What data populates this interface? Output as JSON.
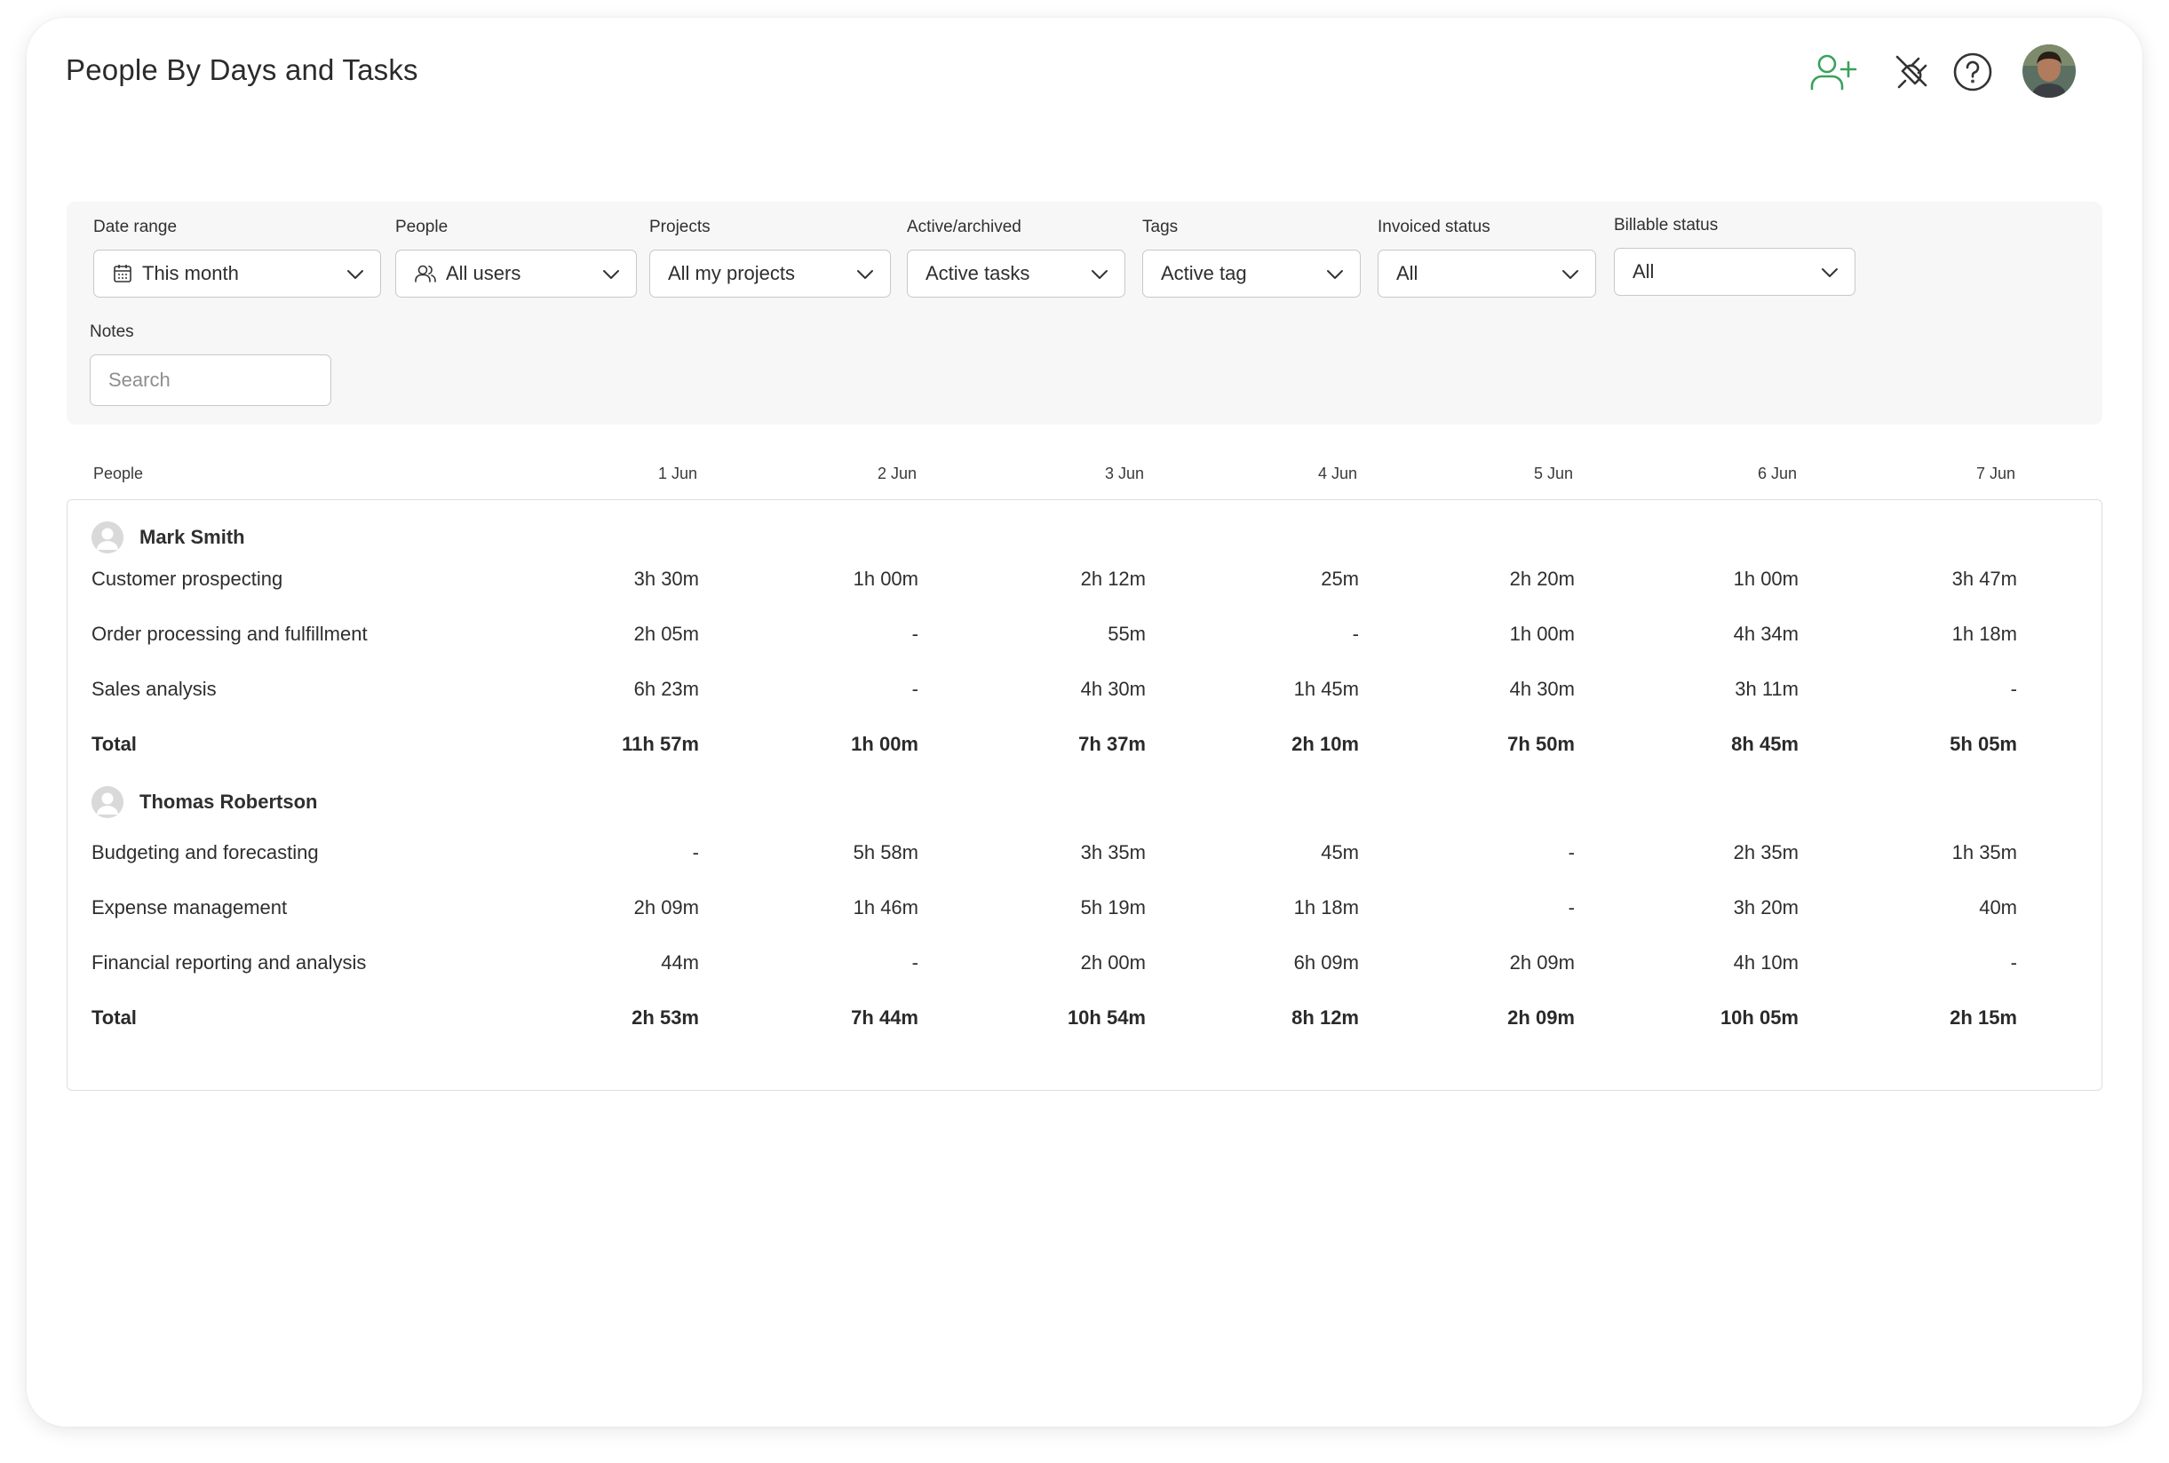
{
  "header": {
    "title": "People By Days and Tasks",
    "accent_color": "#3aa15a",
    "icons": [
      "add-user-icon",
      "plug-icon",
      "help-icon"
    ]
  },
  "filters": {
    "date_range": {
      "label": "Date range",
      "value": "This month"
    },
    "people": {
      "label": "People",
      "value": "All users"
    },
    "projects": {
      "label": "Projects",
      "value": "All my projects"
    },
    "active_archived": {
      "label": "Active/archived",
      "value": "Active tasks"
    },
    "tags": {
      "label": "Tags",
      "value": "Active tag"
    },
    "invoiced_status": {
      "label": "Invoiced status",
      "value": "All"
    },
    "billable_status": {
      "label": "Billable status",
      "value": "All"
    },
    "notes": {
      "label": "Notes",
      "placeholder": "Search"
    }
  },
  "table": {
    "header": [
      "People",
      "1 Jun",
      "2 Jun",
      "3 Jun",
      "4 Jun",
      "5 Jun",
      "6 Jun",
      "7 Jun"
    ],
    "groups": [
      {
        "person": "Mark Smith",
        "rows": [
          {
            "task": "Customer prospecting",
            "values": [
              "3h 30m",
              "1h 00m",
              "2h 12m",
              "25m",
              "2h 20m",
              "1h 00m",
              "3h 47m"
            ]
          },
          {
            "task": "Order processing and fulfillment",
            "values": [
              "2h 05m",
              "-",
              "55m",
              "-",
              "1h 00m",
              "4h 34m",
              "1h 18m"
            ]
          },
          {
            "task": "Sales analysis",
            "values": [
              "6h 23m",
              "-",
              "4h 30m",
              "1h 45m",
              "4h 30m",
              "3h 11m",
              "-"
            ]
          }
        ],
        "total": {
          "label": "Total",
          "values": [
            "11h 57m",
            "1h 00m",
            "7h 37m",
            "2h 10m",
            "7h 50m",
            "8h 45m",
            "5h 05m"
          ]
        }
      },
      {
        "person": "Thomas Robertson",
        "rows": [
          {
            "task": "Budgeting and forecasting",
            "values": [
              "-",
              "5h 58m",
              "3h 35m",
              "45m",
              "-",
              "2h 35m",
              "1h 35m"
            ]
          },
          {
            "task": "Expense management",
            "values": [
              "2h 09m",
              "1h 46m",
              "5h 19m",
              "1h 18m",
              "-",
              "3h 20m",
              "40m"
            ]
          },
          {
            "task": "Financial reporting and analysis",
            "values": [
              "44m",
              "-",
              "2h 00m",
              "6h 09m",
              "2h 09m",
              "4h 10m",
              "-"
            ]
          }
        ],
        "total": {
          "label": "Total",
          "values": [
            "2h 53m",
            "7h 44m",
            "10h 54m",
            "8h 12m",
            "2h 09m",
            "10h 05m",
            "2h 15m"
          ]
        }
      }
    ]
  }
}
